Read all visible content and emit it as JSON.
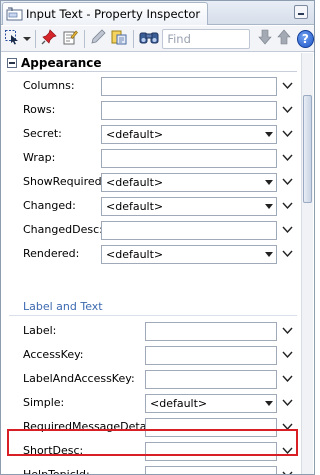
{
  "window": {
    "title": "Input Text - Property Inspector"
  },
  "toolbar": {
    "find_placeholder": "Find",
    "help_label": "?"
  },
  "section": {
    "title": "Appearance"
  },
  "rows_a": [
    {
      "label": "Columns:",
      "kind": "text",
      "value": ""
    },
    {
      "label": "Rows:",
      "kind": "text",
      "value": ""
    },
    {
      "label": "Secret:",
      "kind": "select",
      "value": "<default>"
    },
    {
      "label": "Wrap:",
      "kind": "text",
      "value": ""
    },
    {
      "label": "ShowRequired:",
      "kind": "select",
      "value": "<default>"
    },
    {
      "label": "Changed:",
      "kind": "select",
      "value": "<default>"
    },
    {
      "label": "ChangedDesc:",
      "kind": "text",
      "value": ""
    },
    {
      "label": "Rendered:",
      "kind": "select",
      "value": "<default>"
    }
  ],
  "subsection": {
    "title": "Label and Text"
  },
  "rows_b": [
    {
      "label": "Label:",
      "kind": "text",
      "value": ""
    },
    {
      "label": "AccessKey:",
      "kind": "text",
      "value": ""
    },
    {
      "label": "LabelAndAccessKey:",
      "kind": "text",
      "value": ""
    },
    {
      "label": "Simple:",
      "kind": "select",
      "value": "<default>"
    },
    {
      "label": "RequiredMessageDetail:",
      "kind": "text",
      "value": ""
    },
    {
      "label": "ShortDesc:",
      "kind": "text",
      "value": ""
    },
    {
      "label": "HelpTopicId:",
      "kind": "text",
      "value": ""
    }
  ],
  "colors": {
    "highlight": "#d81f26",
    "subsection": "#3d6ab0"
  }
}
